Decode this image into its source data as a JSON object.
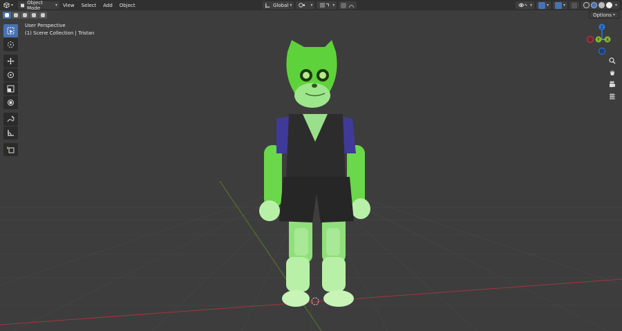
{
  "header": {
    "mode": "Object Mode",
    "menus": [
      "View",
      "Select",
      "Add",
      "Object"
    ],
    "orientation": "Global",
    "options_label": "Options"
  },
  "viewport": {
    "perspective_label": "User Perspective",
    "collection_label": "(1) Scene Collection | Tristan"
  },
  "gizmo": {
    "z_label": "Z",
    "y_label": "Y",
    "x_label": "X"
  },
  "colors": {
    "accent": "#4772b3",
    "header_bg": "#303030",
    "viewport_bg": "#3d3d3d",
    "axis_x": "#d9354a",
    "axis_y": "#83b834",
    "axis_z": "#2b78e0"
  },
  "icons": {
    "editor_type": "cube-icon",
    "tools": [
      "select-box-icon",
      "cursor-icon",
      "move-icon",
      "rotate-icon",
      "scale-icon",
      "transform-icon",
      "annotate-icon",
      "measure-icon",
      "add-cube-icon"
    ],
    "nav": [
      "zoom-icon",
      "hand-icon",
      "camera-icon",
      "grid-icon"
    ]
  }
}
